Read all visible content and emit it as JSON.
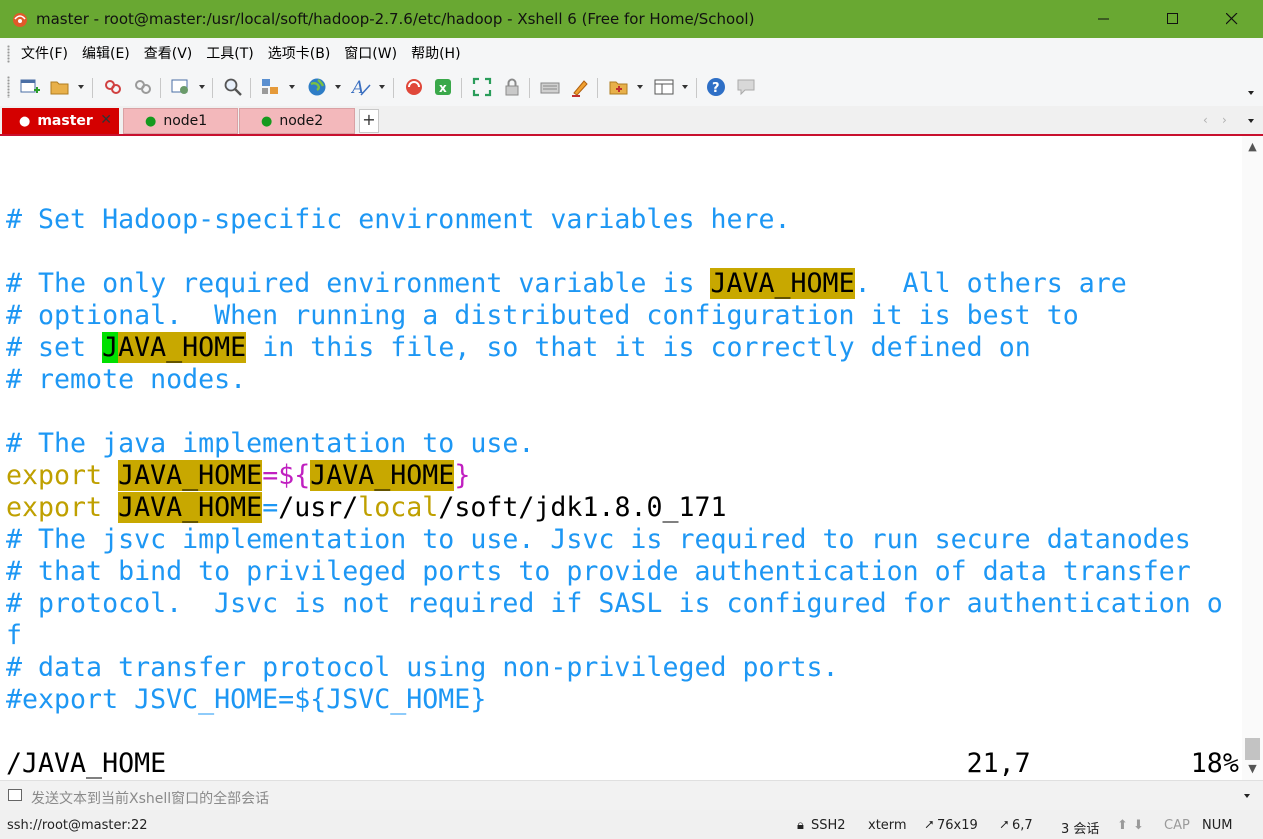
{
  "window": {
    "title": "master - root@master:/usr/local/soft/hadoop-2.7.6/etc/hadoop - Xshell 6 (Free for Home/School)",
    "app_icon": "xshell-logo-icon",
    "controls": [
      "minimize-icon",
      "maximize-icon",
      "close-icon"
    ]
  },
  "menu": [
    "文件(F)",
    "编辑(E)",
    "查看(V)",
    "工具(T)",
    "选项卡(B)",
    "窗口(W)",
    "帮助(H)"
  ],
  "toolbar": {
    "icons": [
      "new-session-icon",
      "open-folder-icon",
      "reconnect-icon",
      "disconnect-icon",
      "properties-icon",
      "find-icon",
      "transfer-icon",
      "globe-icon",
      "font-icon",
      "xftp-icon",
      "xmanager-icon",
      "fullscreen-icon",
      "lock-icon",
      "keyboard-icon",
      "highlight-icon",
      "add-folder-icon",
      "layout-icon",
      "help-icon",
      "chat-icon"
    ]
  },
  "tabs": [
    {
      "label": "master",
      "active": true
    },
    {
      "label": "node1",
      "active": false
    },
    {
      "label": "node2",
      "active": false
    }
  ],
  "tab_add": "+",
  "tab_nav": [
    "‹",
    "›"
  ],
  "terminal": {
    "lines": [
      [],
      [
        {
          "t": "# Set Hadoop-specific environment variables here.",
          "s": "c"
        }
      ],
      [],
      [
        {
          "t": "# The only required environment variable is ",
          "s": "c"
        },
        {
          "t": "JAVA_HOME",
          "s": "hl"
        },
        {
          "t": ".  All others are",
          "s": "c"
        }
      ],
      [
        {
          "t": "# optional.  When running a distributed configuration it is best to",
          "s": "c"
        }
      ],
      [
        {
          "t": "# set ",
          "s": "c"
        },
        {
          "t": "J",
          "s": "cur"
        },
        {
          "t": "AVA_HOME",
          "s": "hl"
        },
        {
          "t": " in this file, so that it is correctly defined on",
          "s": "c"
        }
      ],
      [
        {
          "t": "# remote nodes.",
          "s": "c"
        }
      ],
      [],
      [
        {
          "t": "# The java implementation to use.",
          "s": "c"
        }
      ],
      [
        {
          "t": "export ",
          "s": "y"
        },
        {
          "t": "JAVA_HOME",
          "s": "hl"
        },
        {
          "t": "=${",
          "s": "m"
        },
        {
          "t": "JAVA_HOME",
          "s": "hl"
        },
        {
          "t": "}",
          "s": "m"
        }
      ],
      [
        {
          "t": "export ",
          "s": "y"
        },
        {
          "t": "JAVA_HOME",
          "s": "hl"
        },
        {
          "t": "=",
          "s": "c"
        },
        {
          "t": "/usr/",
          "s": "d"
        },
        {
          "t": "local",
          "s": "y"
        },
        {
          "t": "/soft/jdk1.8.0_171",
          "s": "d"
        }
      ],
      [
        {
          "t": "# The jsvc implementation to use. Jsvc is required to run secure datanodes",
          "s": "c"
        }
      ],
      [
        {
          "t": "# that bind to privileged ports to provide authentication of data transfer",
          "s": "c"
        }
      ],
      [
        {
          "t": "# protocol.  Jsvc is not required if SASL is configured for authentication o",
          "s": "c"
        }
      ],
      [
        {
          "t": "f",
          "s": "c"
        }
      ],
      [
        {
          "t": "# data transfer protocol using non-privileged ports.",
          "s": "c"
        }
      ],
      [
        {
          "t": "#export JSVC_HOME=${JSVC_HOME}",
          "s": "c"
        }
      ],
      [],
      [
        {
          "t": "/JAVA_HOME                                                  21,7          18%",
          "s": "d"
        }
      ]
    ]
  },
  "compose": {
    "placeholder": "发送文本到当前Xshell窗口的全部会话"
  },
  "status": {
    "connection": "ssh://root@master:22",
    "protocol": "SSH2",
    "terminal_type": "xterm",
    "size": "76x19",
    "cursor": "6,7",
    "sessions": "3 会话",
    "cap": "CAP",
    "num": "NUM"
  },
  "colors": {
    "titlebar": "#69a832",
    "active_tab": "#d40000",
    "comment": "#1d97f4",
    "keyword": "#bfa000",
    "match_highlight": "#c8a800",
    "cursor": "#00e000"
  }
}
